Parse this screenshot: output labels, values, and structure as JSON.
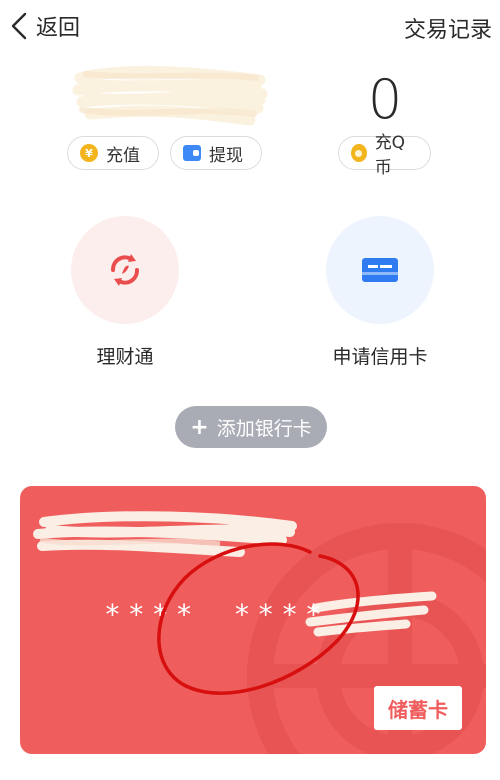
{
  "header": {
    "back_label": "返回",
    "history_label": "交易记录"
  },
  "balance": {
    "qcoin_count": "0"
  },
  "actions": {
    "recharge_label": "充值",
    "withdraw_label": "提现",
    "recharge_qcoin_label": "充Q币"
  },
  "features": {
    "wealth_label": "理财通",
    "credit_card_label": "申请信用卡"
  },
  "add_card": {
    "label": "添加银行卡"
  },
  "bank_card": {
    "number_groups": [
      "****",
      "****"
    ],
    "type_label": "储蓄卡"
  },
  "colors": {
    "card_red": "#f05d5d",
    "coin_yellow": "#f3b51e",
    "wallet_blue": "#3d8af7",
    "add_card_gray": "#a9acb5"
  }
}
